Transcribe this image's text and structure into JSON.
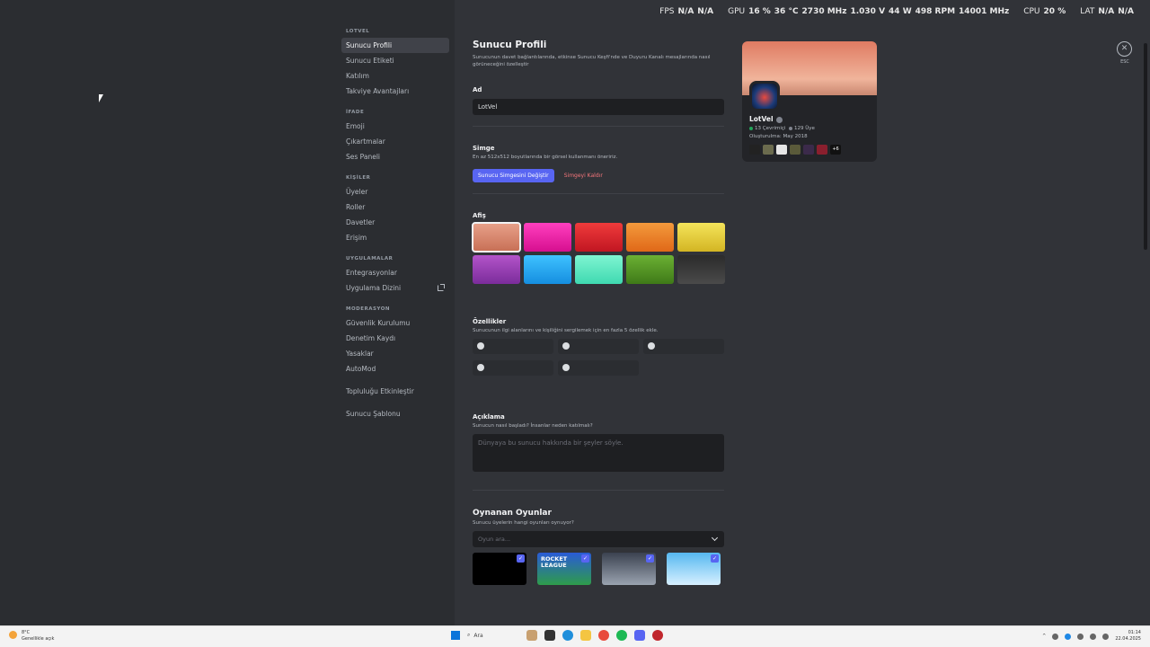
{
  "overlay": {
    "fps_label": "FPS",
    "fps1": "N/A",
    "fps2": "N/A",
    "gpu_label": "GPU",
    "gpu_load": "16 %",
    "gpu_temp": "36 °C",
    "gpu_clock": "2730 MHz",
    "gpu_volt": "1.030 V",
    "gpu_power": "44 W",
    "gpu_fan": "498 RPM",
    "gpu_mem": "14001 MHz",
    "cpu_label": "CPU",
    "cpu_load": "20 %",
    "lat_label": "LAT",
    "lat1": "N/A",
    "lat2": "N/A"
  },
  "sidebar": {
    "server_header": "LOTVEL",
    "server_items": [
      "Sunucu Profili",
      "Sunucu Etiketi",
      "Katılım",
      "Takviye Avantajları"
    ],
    "expression_header": "İFADE",
    "expression_items": [
      "Emoji",
      "Çıkartmalar",
      "Ses Paneli"
    ],
    "people_header": "KİŞİLER",
    "people_items": [
      "Üyeler",
      "Roller",
      "Davetler",
      "Erişim"
    ],
    "apps_header": "UYGULAMALAR",
    "apps_items": [
      "Entegrasyonlar",
      "Uygulama Dizini"
    ],
    "moderation_header": "MODERASYON",
    "moderation_items": [
      "Güvenlik Kurulumu",
      "Denetim Kaydı",
      "Yasaklar",
      "AutoMod"
    ],
    "community_item": "Topluluğu Etkinleştir",
    "template_item": "Sunucu Şablonu"
  },
  "main": {
    "title": "Sunucu Profili",
    "subtitle": "Sunucunun davet bağlantılarında, etkinse Sunucu Keşfi'nde ve Duyuru Kanalı mesajlarında nasıl görüneceğini özelleştir",
    "name_label": "Ad",
    "name_value": "LotVel",
    "icon_label": "Simge",
    "icon_hint": "En az 512x512 boyutlarında bir görsel kullanmanı öneririz.",
    "change_icon_button": "Sunucu Simgesini Değiştir",
    "remove_icon_button": "Simgeyi Kaldır",
    "banner_label": "Afiş",
    "banners": [
      {
        "from": "#e8a18a",
        "to": "#c76f55"
      },
      {
        "from": "#ff3fbf",
        "to": "#d60f8f"
      },
      {
        "from": "#ef3b3b",
        "to": "#c11622"
      },
      {
        "from": "#f39a3c",
        "to": "#e06818"
      },
      {
        "from": "#f4e45a",
        "to": "#d3b523"
      },
      {
        "from": "#b354c9",
        "to": "#7b2c9b"
      },
      {
        "from": "#3fc2ff",
        "to": "#158ee0"
      },
      {
        "from": "#7ff5d2",
        "to": "#3fd9b0"
      },
      {
        "from": "#6bb033",
        "to": "#3f7a18"
      },
      {
        "from": "#2b2b2b",
        "to": "#4a4a4a"
      }
    ],
    "traits_label": "Özellikler",
    "traits_hint": "Sunucunun ilgi alanlarını ve kişiliğini sergilemek için en fazla 5 özellik ekle.",
    "description_label": "Açıklama",
    "description_hint": "Sunucun nasıl başladı? İnsanlar neden katılmalı?",
    "description_placeholder": "Dünyaya bu sunucu hakkında bir şeyler söyle.",
    "games_title": "Oynanan Oyunlar",
    "games_hint": "Sunucu üyelerin hangi oyunları oynuyor?",
    "games_search_placeholder": "Oyun ara...",
    "game_tile_text": "ROCKET LEAGUE"
  },
  "preview": {
    "name": "LotVel",
    "online": "13 Çevrimiçi",
    "members": "129 Üye",
    "created": "Oluşturulma: May 2018",
    "tag_more": "+6"
  },
  "esc_label": "ESC",
  "taskbar": {
    "temp": "8°C",
    "weather": "Genellikle açık",
    "search": "Ara",
    "time": "01:14",
    "date": "22.04.2025"
  }
}
